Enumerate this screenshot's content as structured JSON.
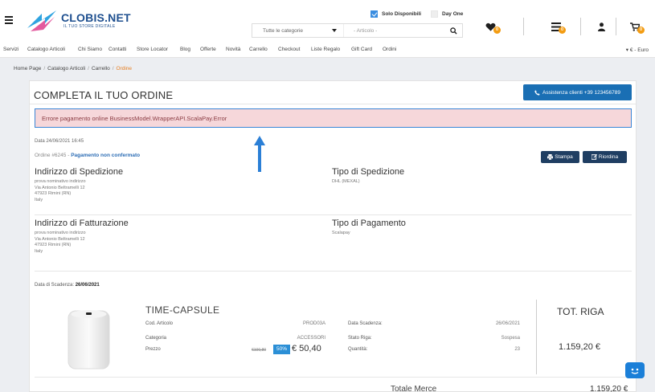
{
  "header": {
    "logo_title": "CLOBIS.NET",
    "logo_subtitle": "IL TUO STORE DIGITALE",
    "only_available_label": "Solo Disponibili",
    "day_one_label": "Day One",
    "category_select": "Tutte le categorie",
    "search_placeholder": "- Articolo -",
    "wishlist_count": "0",
    "compare_count": "0",
    "cart_count": "0"
  },
  "nav": {
    "items": [
      "Servizi",
      "Catalogo Articoli",
      "Chi Siamo",
      "Contatti",
      "Store Locator",
      "Blog",
      "Offerte",
      "Novità",
      "Carrello",
      "Checkout",
      "Liste Regalo",
      "Gift Card",
      "Ordini"
    ],
    "currency": "€ - Euro"
  },
  "breadcrumb": [
    "Home Page",
    "Catalogo Articoli",
    "Carrello",
    "Ordine"
  ],
  "page": {
    "title": "COMPLETA IL TUO ORDINE",
    "assist_label": "Assistenza clienti +39 1234567​89",
    "error_message": "Errore pagamento online BusinessModel.WrapperAPI.ScalaPay.Error",
    "date_line": "Data 24/06/2021 16:45",
    "order_number": "Ordine #6245 -",
    "order_status": "Pagamento non confermato",
    "print_label": "Stampa",
    "reorder_label": "Riordina"
  },
  "shipping": {
    "title": "Indirizzo di Spedizione",
    "lines": [
      "prova nominativo indirizzo",
      "Via Antonio Beltramelli 12",
      "47923 Rimini (RN)",
      "Italy"
    ],
    "type_title": "Tipo di Spedizione",
    "type_value": "DHL (MEXAL)"
  },
  "billing": {
    "title": "Indirizzo di Fatturazione",
    "lines": [
      "prova nominativo indirizzo",
      "Via Antonio Beltramelli 12",
      "47923 Rimini (RN)",
      "Italy"
    ],
    "payment_title": "Tipo di Pagamento",
    "payment_value": "Scalapay"
  },
  "due": {
    "label": "Data di Scadenza:",
    "value": "26/06/2021"
  },
  "product": {
    "name": "TIME-CAPSULE",
    "code_label": "Cod. Articolo",
    "code_value": "PROD03A",
    "category_label": "Categoria",
    "category_value": "ACCESSORI",
    "price_label": "Prezzo",
    "price_old": "€100,80",
    "discount": "50%",
    "price_new": "€ 50,40",
    "due_label": "Data Scadenza:",
    "due_value": "26/06/2021",
    "state_label": "Stato Riga:",
    "state_value": "Sospesa",
    "qty_label": "Quantità:",
    "qty_value": "23",
    "row_total_label": "TOT. RIGA",
    "row_total_value": "1.159,20 €"
  },
  "totals": {
    "goods_label": "Totale Merce",
    "goods_value": "1.159,20 €"
  },
  "colors": {
    "brand_blue": "#1e4f8f",
    "accent_orange": "#f39c12",
    "error_bg": "#f6d7da",
    "arrow_blue": "#2b7fd6"
  }
}
